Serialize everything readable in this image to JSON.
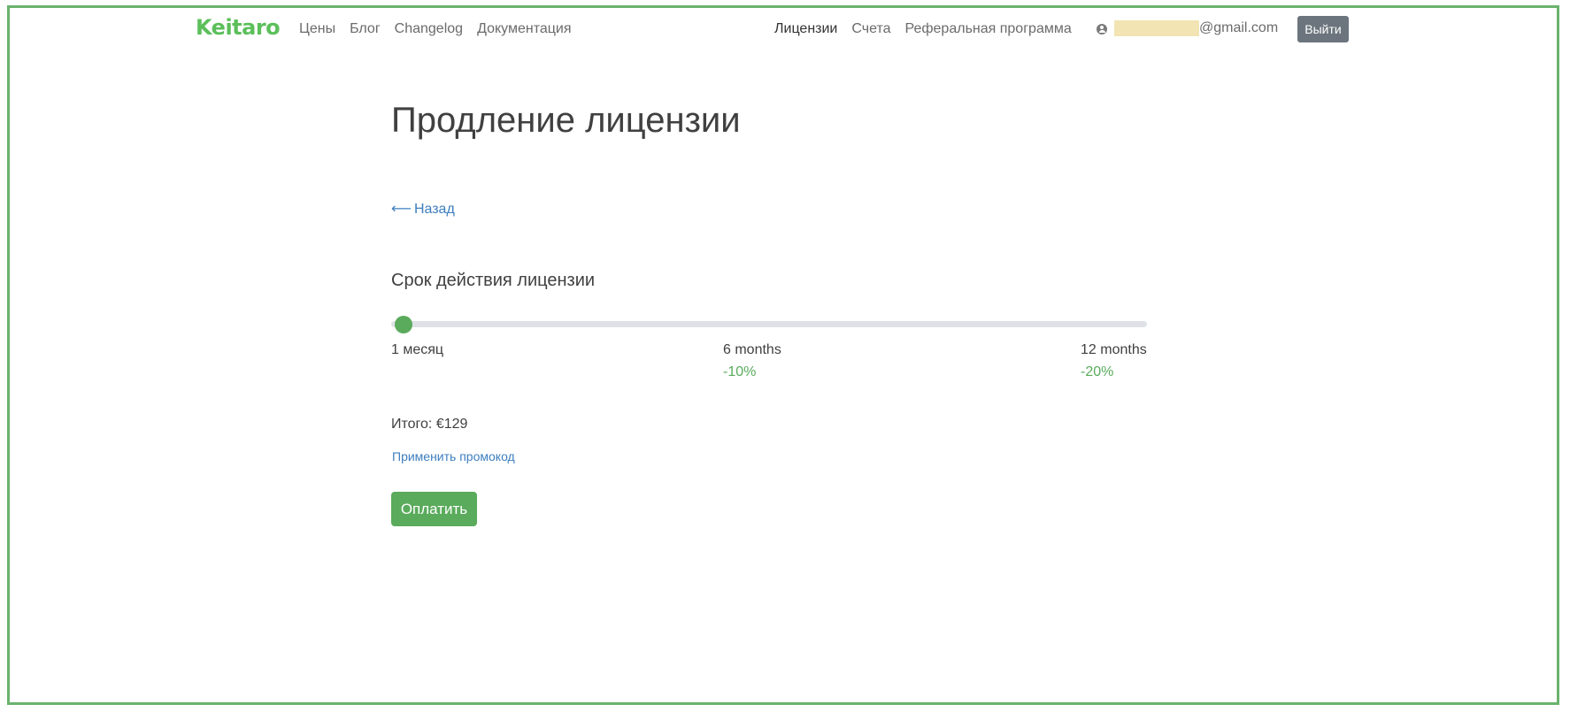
{
  "brand": {
    "logo_text": "Keitaro",
    "accent_color": "#5bbf5a",
    "frame_color": "#6ab36d"
  },
  "nav": {
    "left_items": [
      {
        "label": "Цены"
      },
      {
        "label": "Блог"
      },
      {
        "label": "Changelog"
      },
      {
        "label": "Документация"
      }
    ],
    "right_items": [
      {
        "label": "Лицензии",
        "active": true
      },
      {
        "label": "Счета",
        "active": false
      },
      {
        "label": "Реферальная программа",
        "active": false
      }
    ],
    "user": {
      "icon": "user-circle-icon",
      "email_visible_part": "@gmail.com"
    },
    "logout_label": "Выйти"
  },
  "main": {
    "title": "Продление лицензии",
    "back_arrow": "⟵",
    "back_label": "Назад",
    "period_label": "Срок действия лицензии",
    "slider": {
      "selected_index": 0,
      "ticks": [
        {
          "label": "1 месяц",
          "discount": ""
        },
        {
          "label": "6 months",
          "discount": "-10%"
        },
        {
          "label": "12 months",
          "discount": "-20%"
        }
      ]
    },
    "total_label": "Итого:",
    "total_value": "€129",
    "promo_label": "Применить промокод",
    "pay_label": "Оплатить"
  }
}
